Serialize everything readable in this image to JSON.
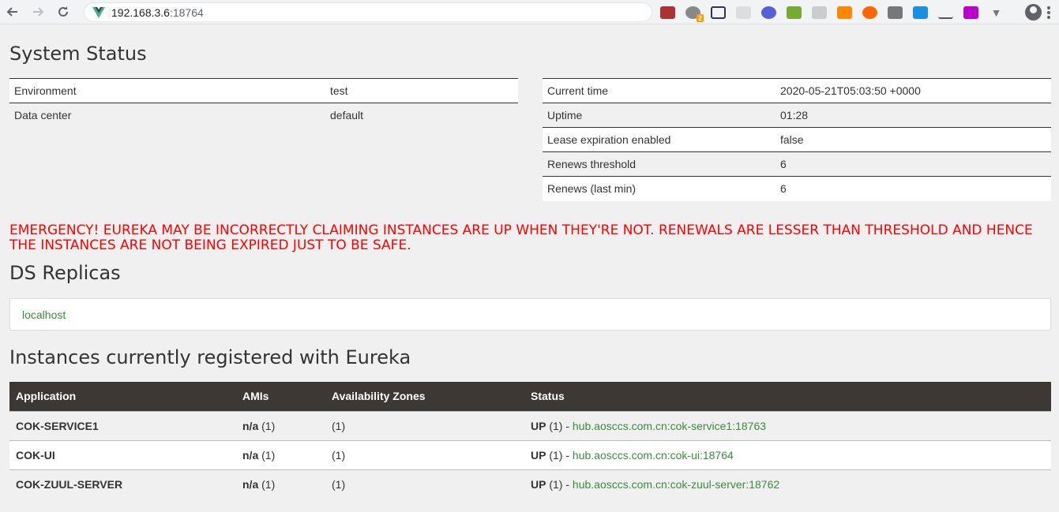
{
  "browser": {
    "host": "192.168.3.6",
    "port": ":18764",
    "extension_badge": "2"
  },
  "system_status": {
    "title": "System Status",
    "left": [
      {
        "key": "Environment",
        "value": "test"
      },
      {
        "key": "Data center",
        "value": "default"
      }
    ],
    "right": [
      {
        "key": "Current time",
        "value": "2020-05-21T05:03:50 +0000"
      },
      {
        "key": "Uptime",
        "value": "01:28"
      },
      {
        "key": "Lease expiration enabled",
        "value": "false"
      },
      {
        "key": "Renews threshold",
        "value": "6"
      },
      {
        "key": "Renews (last min)",
        "value": "6"
      }
    ]
  },
  "emergency": "EMERGENCY! EUREKA MAY BE INCORRECTLY CLAIMING INSTANCES ARE UP WHEN THEY'RE NOT. RENEWALS ARE LESSER THAN THRESHOLD AND HENCE THE INSTANCES ARE NOT BEING EXPIRED JUST TO BE SAFE.",
  "ds_replicas": {
    "title": "DS Replicas",
    "items": [
      "localhost"
    ]
  },
  "instances": {
    "title": "Instances currently registered with Eureka",
    "headers": [
      "Application",
      "AMIs",
      "Availability Zones",
      "Status"
    ],
    "rows": [
      {
        "app": "COK-SERVICE1",
        "ami": "n/a",
        "ami_count": " (1)",
        "zones": "(1)",
        "status": "UP",
        "status_count": " (1) - ",
        "link": "hub.aosccs.com.cn:cok-service1:18763"
      },
      {
        "app": "COK-UI",
        "ami": "n/a",
        "ami_count": " (1)",
        "zones": "(1)",
        "status": "UP",
        "status_count": " (1) - ",
        "link": "hub.aosccs.com.cn:cok-ui:18764"
      },
      {
        "app": "COK-ZUUL-SERVER",
        "ami": "n/a",
        "ami_count": " (1)",
        "zones": "(1)",
        "status": "UP",
        "status_count": " (1) - ",
        "link": "hub.aosccs.com.cn:cok-zuul-server:18762"
      }
    ]
  },
  "colors": {
    "emergency": "#ff0000",
    "link": "#3b8a3b",
    "table_header": "#3d3834"
  }
}
